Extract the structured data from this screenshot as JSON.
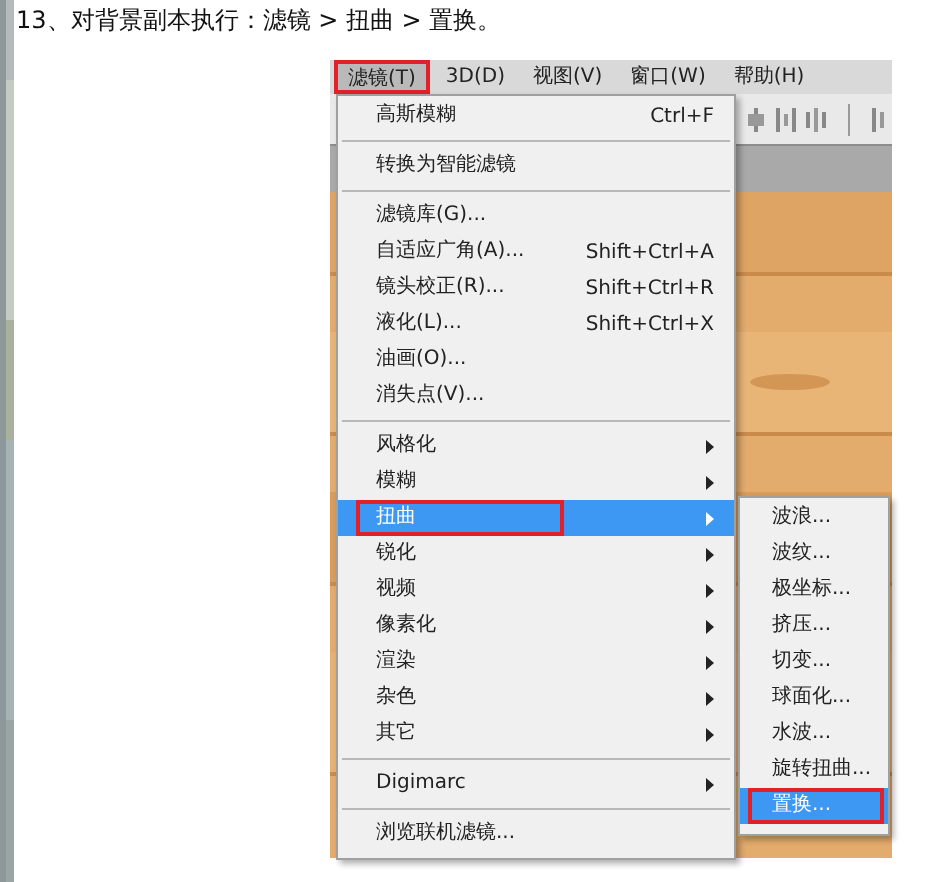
{
  "caption": "13、对背景副本执行：滤镜 > 扭曲 > 置换。",
  "menubar": [
    {
      "label": "滤镜(T)",
      "selected": true,
      "annotated": true
    },
    {
      "label": "3D(D)",
      "selected": false,
      "annotated": false
    },
    {
      "label": "视图(V)",
      "selected": false,
      "annotated": false
    },
    {
      "label": "窗口(W)",
      "selected": false,
      "annotated": false
    },
    {
      "label": "帮助(H)",
      "selected": false,
      "annotated": false
    }
  ],
  "menu": [
    {
      "kind": "item",
      "label": "高斯模糊",
      "shortcut": "Ctrl+F",
      "selected": false,
      "annotated": false
    },
    {
      "kind": "separator"
    },
    {
      "kind": "item",
      "label": "转换为智能滤镜",
      "selected": false,
      "annotated": false
    },
    {
      "kind": "separator"
    },
    {
      "kind": "item",
      "label": "滤镜库(G)...",
      "selected": false,
      "annotated": false
    },
    {
      "kind": "item",
      "label": "自适应广角(A)...",
      "shortcut": "Shift+Ctrl+A",
      "selected": false,
      "annotated": false
    },
    {
      "kind": "item",
      "label": "镜头校正(R)...",
      "shortcut": "Shift+Ctrl+R",
      "selected": false,
      "annotated": false
    },
    {
      "kind": "item",
      "label": "液化(L)...",
      "shortcut": "Shift+Ctrl+X",
      "selected": false,
      "annotated": false
    },
    {
      "kind": "item",
      "label": "油画(O)...",
      "selected": false,
      "annotated": false
    },
    {
      "kind": "item",
      "label": "消失点(V)...",
      "selected": false,
      "annotated": false
    },
    {
      "kind": "separator"
    },
    {
      "kind": "submenu",
      "label": "风格化",
      "selected": false,
      "annotated": false
    },
    {
      "kind": "submenu",
      "label": "模糊",
      "selected": false,
      "annotated": false
    },
    {
      "kind": "submenu",
      "label": "扭曲",
      "selected": true,
      "annotated": true
    },
    {
      "kind": "submenu",
      "label": "锐化",
      "selected": false,
      "annotated": false
    },
    {
      "kind": "submenu",
      "label": "视频",
      "selected": false,
      "annotated": false
    },
    {
      "kind": "submenu",
      "label": "像素化",
      "selected": false,
      "annotated": false
    },
    {
      "kind": "submenu",
      "label": "渲染",
      "selected": false,
      "annotated": false
    },
    {
      "kind": "submenu",
      "label": "杂色",
      "selected": false,
      "annotated": false
    },
    {
      "kind": "submenu",
      "label": "其它",
      "selected": false,
      "annotated": false
    },
    {
      "kind": "separator"
    },
    {
      "kind": "submenu",
      "label": "Digimarc",
      "selected": false,
      "annotated": false
    },
    {
      "kind": "separator"
    },
    {
      "kind": "item",
      "label": "浏览联机滤镜...",
      "selected": false,
      "annotated": false
    }
  ],
  "submenu": [
    {
      "label": "波浪...",
      "selected": false,
      "annotated": false
    },
    {
      "label": "波纹...",
      "selected": false,
      "annotated": false
    },
    {
      "label": "极坐标...",
      "selected": false,
      "annotated": false
    },
    {
      "label": "挤压...",
      "selected": false,
      "annotated": false
    },
    {
      "label": "切变...",
      "selected": false,
      "annotated": false
    },
    {
      "label": "球面化...",
      "selected": false,
      "annotated": false
    },
    {
      "label": "水波...",
      "selected": false,
      "annotated": false
    },
    {
      "label": "旋转扭曲...",
      "selected": false,
      "annotated": false
    },
    {
      "label": "置换...",
      "selected": true,
      "annotated": true
    }
  ]
}
